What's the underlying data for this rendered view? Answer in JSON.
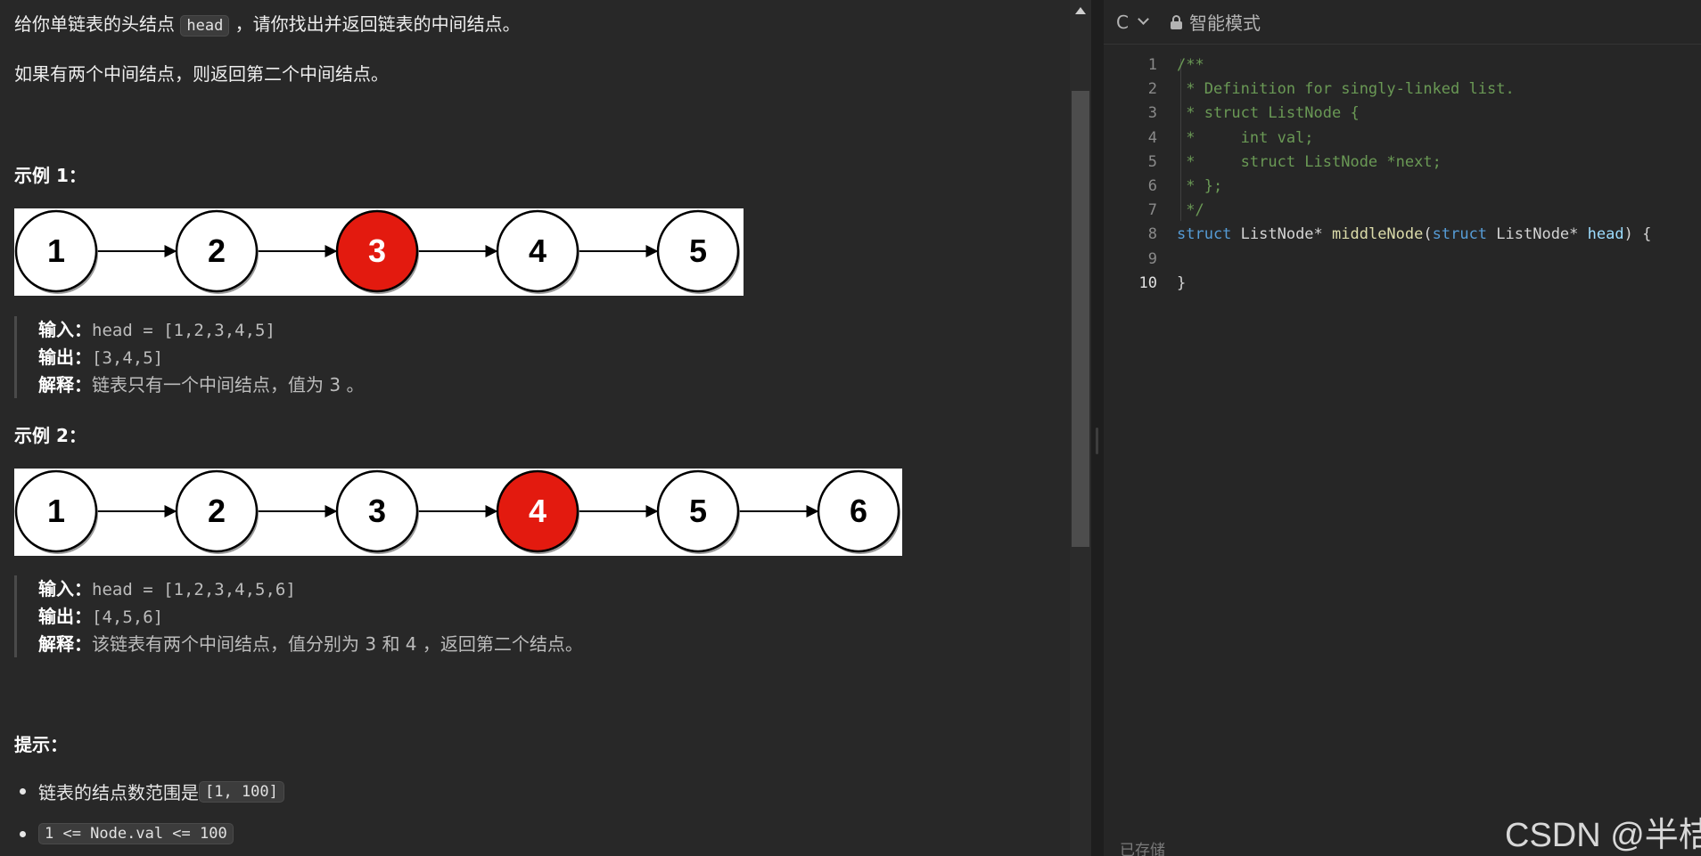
{
  "problem": {
    "intro_before": "给你单链表的头结点 ",
    "intro_code": "head",
    "intro_after": " ，请你找出并返回链表的中间结点。",
    "rule": "如果有两个中间结点，则返回第二个中间结点。",
    "examples": [
      {
        "title": "示例 1：",
        "nodes": [
          "1",
          "2",
          "3",
          "4",
          "5"
        ],
        "highlight_index": 2,
        "input_label": "输入：",
        "input": "head = [1,2,3,4,5]",
        "output_label": "输出：",
        "output": "[3,4,5]",
        "explain_label": "解释：",
        "explain": "链表只有一个中间结点，值为 3 。"
      },
      {
        "title": "示例 2：",
        "nodes": [
          "1",
          "2",
          "3",
          "4",
          "5",
          "6"
        ],
        "highlight_index": 3,
        "input_label": "输入：",
        "input": "head = [1,2,3,4,5,6]",
        "output_label": "输出：",
        "output": "[4,5,6]",
        "explain_label": "解释：",
        "explain": "该链表有两个中间结点，值分别为 3 和 4 ，返回第二个结点。"
      }
    ],
    "constraints_title": "提示：",
    "constraints": [
      {
        "text": "链表的结点数范围是 ",
        "code": "[1, 100]"
      },
      {
        "text": "",
        "code": "1 <= Node.val <= 100"
      }
    ]
  },
  "editor": {
    "language": "C",
    "mode": "智能模式",
    "status": "已存储",
    "active_line": 10,
    "lines": [
      {
        "no": "1",
        "comment": "/**"
      },
      {
        "no": "2",
        "comment": " * Definition for singly-linked list."
      },
      {
        "no": "3",
        "comment": " * struct ListNode {"
      },
      {
        "no": "4",
        "comment": " *     int val;"
      },
      {
        "no": "5",
        "comment": " *     struct ListNode *next;"
      },
      {
        "no": "6",
        "comment": " * };"
      },
      {
        "no": "7",
        "comment": " */"
      },
      {
        "no": "8",
        "kw1": "struct",
        "t1": " ListNode* ",
        "fn": "middleNode",
        "t2": "(",
        "kw2": "struct",
        "t3": " ListNode* ",
        "pm": "head",
        "t4": ") {"
      },
      {
        "no": "9",
        "text": ""
      },
      {
        "no": "10",
        "text": "}"
      }
    ]
  },
  "watermark": "CSDN @半桔",
  "colors": {
    "highlight_node": "#e31a0f",
    "node_fill": "#ffffff",
    "comment": "#6a9955",
    "keyword": "#569cd6",
    "function": "#dcdcaa",
    "param": "#9cdcfe"
  }
}
